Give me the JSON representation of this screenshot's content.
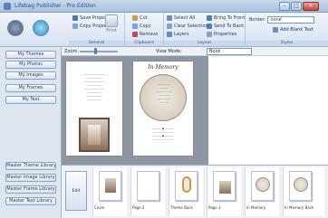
{
  "window": {
    "title": "Lifebag Publisher - Pro Edition"
  },
  "ribbon": {
    "project": {
      "save": "Save Project",
      "copy": "Copy Project",
      "print": "Print",
      "group_label": "General"
    },
    "clipboard": {
      "cut": "Cut",
      "copy": "Copy",
      "remove": "Remove",
      "group_label": "Clipboard"
    },
    "layout": {
      "select_all": "Select All",
      "clear_selection": "Clear Selection",
      "layers": "Layers",
      "bring_front": "Bring To Front",
      "send_back": "Send To Back",
      "properties": "Properties",
      "group_label": "Layout"
    },
    "styles": {
      "border_label": "Border:",
      "border_value": "none",
      "add_text": "Add Blank Text",
      "group_label": "Styles"
    }
  },
  "sidebar": {
    "top_items": [
      "My Themes",
      "My Photos",
      "My Images",
      "My Frames",
      "My Text"
    ],
    "bottom_items": [
      "Master Theme Library",
      "Master Image Library",
      "Master Frame Library",
      "Master Text Library"
    ]
  },
  "toolbar": {
    "zoom_label": "Zoom:",
    "view_mode_label": "View Mode:",
    "view_mode_value": "Book"
  },
  "page_content": {
    "memory_title": "In Memory"
  },
  "thumbnails": {
    "edit_pages": "Edit Pages",
    "items": [
      "Cover",
      "Page 2",
      "Theme Back",
      "Page 3",
      "In Memory",
      "In Memory Back"
    ]
  },
  "colors": {
    "ribbon_bg": "#d6e2f2",
    "accent": "#5b7fb3",
    "page_gray": "#8e96a2"
  }
}
